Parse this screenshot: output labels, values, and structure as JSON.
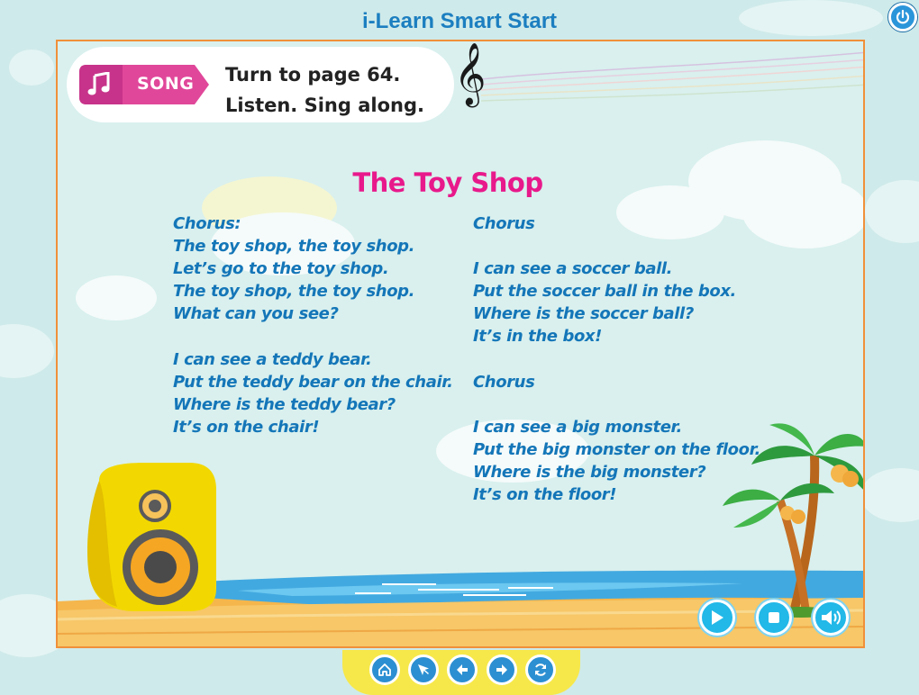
{
  "app": {
    "title": "i-Learn Smart Start"
  },
  "activity": {
    "tag_label": "SONG",
    "instruction_line1": "Turn to page 64.",
    "instruction_line2": "Listen. Sing along."
  },
  "song": {
    "title": "The Toy Shop",
    "left_column": [
      "Chorus:",
      "The toy shop, the toy shop.",
      "Let’s go to the toy shop.",
      "The toy shop, the toy shop.",
      "What can you see?",
      "",
      "I can see a teddy bear.",
      "Put the teddy bear on the chair.",
      "Where is the teddy bear?",
      "It’s on the chair!"
    ],
    "right_column": [
      "Chorus",
      "",
      "I can see a soccer ball.",
      "Put the soccer ball in the box.",
      "Where is the soccer ball?",
      "It’s in the box!",
      "",
      "Chorus",
      "",
      "I can see a big monster.",
      "Put the big monster on the floor.",
      "Where is the big monster?",
      "It’s on the floor!"
    ]
  },
  "player_controls": [
    "play-icon",
    "stop-icon",
    "volume-icon"
  ],
  "nav_buttons": [
    "home-icon",
    "pointer-icon",
    "back-arrow-icon",
    "next-arrow-icon",
    "refresh-icon"
  ],
  "colors": {
    "title_blue": "#1c7fc0",
    "song_title_pink": "#e8198b",
    "lyrics_blue": "#1476b8",
    "frame_orange": "#f0903a",
    "tag_pink": "#e0479a",
    "control_blue": "#22b8e8",
    "nav_yellow": "#f6e84a"
  }
}
